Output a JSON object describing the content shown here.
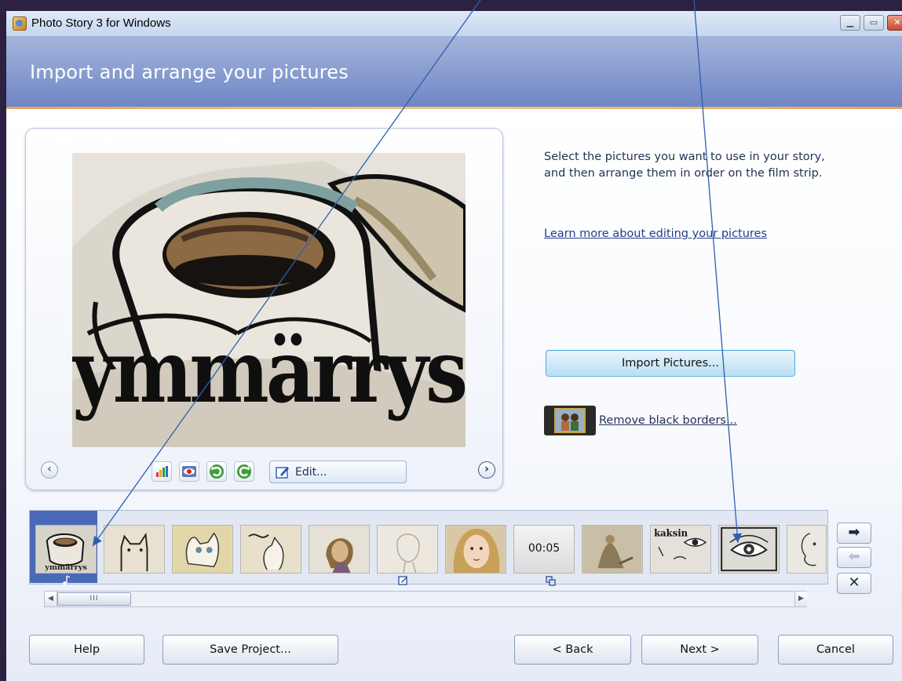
{
  "window": {
    "title": "Photo Story 3 for Windows",
    "controls": [
      "minimize",
      "maximize",
      "close"
    ]
  },
  "header": {
    "title": "Import and arrange your pictures"
  },
  "preview": {
    "caption_text": "ymmärrys",
    "tools": [
      {
        "icon": "auto-fix-icon"
      },
      {
        "icon": "red-eye-icon"
      },
      {
        "icon": "rotate-left-icon"
      },
      {
        "icon": "rotate-right-icon"
      }
    ],
    "edit_label": "Edit..."
  },
  "instructions": {
    "text": "Select the pictures you want to use in your story, and then arrange them in order on the film strip.",
    "learn_more_link": "Learn more about editing your pictures"
  },
  "actions": {
    "import_label": "Import Pictures...",
    "remove_borders_label": "Remove black borders..."
  },
  "filmstrip": {
    "items": [
      {
        "kind": "coffee",
        "selected": true,
        "badge": "music-note-icon",
        "label": "ymmärrys"
      },
      {
        "kind": "cat-sketch"
      },
      {
        "kind": "cat-sketch-2"
      },
      {
        "kind": "cat-sketch-3"
      },
      {
        "kind": "girl-portrait"
      },
      {
        "kind": "faint-sketch",
        "badge": "edit-icon"
      },
      {
        "kind": "girl-face"
      },
      {
        "kind": "blank",
        "duration": "00:05",
        "badge": "transition-icon"
      },
      {
        "kind": "figure-sitting"
      },
      {
        "kind": "text-eye",
        "label": "kaksin"
      },
      {
        "kind": "eye"
      },
      {
        "kind": "face-sketch"
      }
    ]
  },
  "strip_controls": [
    "move-right-icon",
    "move-left-icon",
    "remove-icon"
  ],
  "buttons": {
    "help": "Help",
    "save": "Save Project...",
    "back": "< Back",
    "next": "Next >",
    "cancel": "Cancel"
  },
  "colors": {
    "header": "#7d92cc",
    "accent": "#e7a35c",
    "selected_thumb": "#4a69b9",
    "outer_background": "#2c2140"
  }
}
